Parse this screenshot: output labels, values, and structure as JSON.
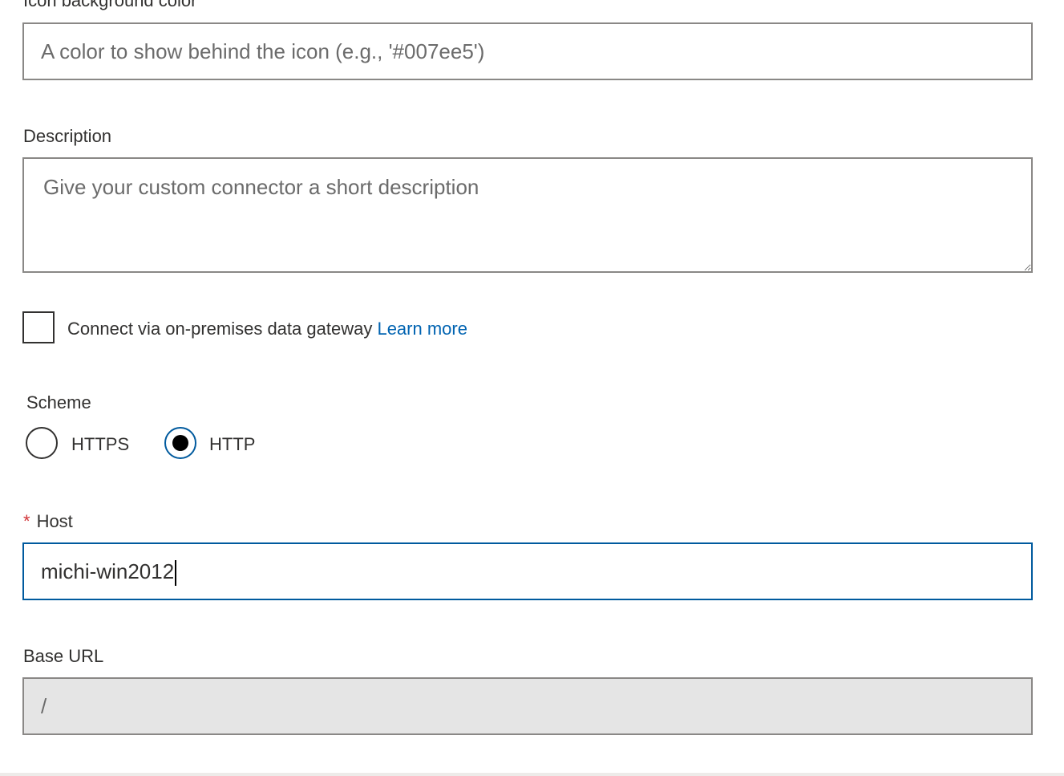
{
  "icon_background": {
    "label": "Icon background color",
    "placeholder": "A color to show behind the icon (e.g., '#007ee5')",
    "value": ""
  },
  "description": {
    "label": "Description",
    "placeholder": "Give your custom connector a short description",
    "value": ""
  },
  "gateway": {
    "checked": false,
    "label": "Connect via on-premises data gateway",
    "link_text": "Learn more"
  },
  "scheme": {
    "label": "Scheme",
    "options": [
      {
        "label": "HTTPS",
        "selected": false
      },
      {
        "label": "HTTP",
        "selected": true
      }
    ]
  },
  "host": {
    "required_marker": "*",
    "label": "Host",
    "value": "michi-win2012"
  },
  "base_url": {
    "label": "Base URL",
    "value": "/"
  },
  "colors": {
    "focus_border": "#005a9e",
    "link": "#0063b1",
    "required": "#d13438",
    "disabled_bg": "#e5e5e5"
  }
}
